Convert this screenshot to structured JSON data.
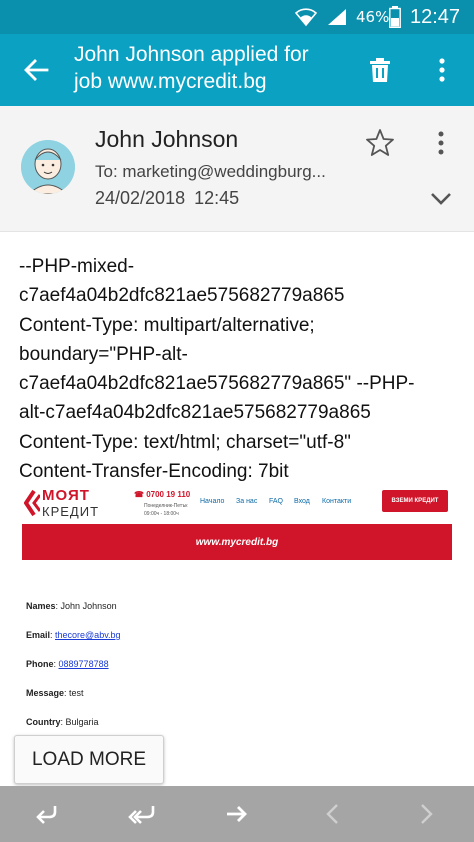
{
  "status_bar": {
    "battery": "46%",
    "time": "12:47"
  },
  "app_bar": {
    "title": "John Johnson applied for job www.mycredit.bg"
  },
  "email_header": {
    "sender": "John Johnson",
    "to": "To: marketing@weddingburg...",
    "date": "24/02/2018",
    "time": "12:45"
  },
  "raw_body": {
    "lines": [
      "--PHP-mixed-",
      "c7aef4a04b2dfc821ae575682779a865",
      "Content-Type: multipart/alternative;",
      "boundary=\"PHP-alt-",
      "c7aef4a04b2dfc821ae575682779a865\" --PHP-",
      "alt-c7aef4a04b2dfc821ae575682779a865",
      "Content-Type: text/html; charset=\"utf-8\"",
      "Content-Transfer-Encoding: 7bit"
    ]
  },
  "newsletter": {
    "logo_line1": "МОЯТ",
    "logo_line2": "КРЕДИТ",
    "phone": "0700 19 110",
    "hours_days": "Понеделник-Петък",
    "hours_time": "09:00ч - 18:00ч",
    "nav": [
      "Начало",
      "За нас",
      "FAQ",
      "Вход",
      "Контакти"
    ],
    "cta": "ВЗЕМИ КРЕДИТ",
    "banner": "www.mycredit.bg"
  },
  "fields": [
    {
      "label": "Names",
      "value": "John Johnson",
      "link": false
    },
    {
      "label": "Email",
      "value": "thecore@abv.bg",
      "link": true
    },
    {
      "label": "Phone",
      "value": "0889778788",
      "link": true
    },
    {
      "label": "Message",
      "value": "test",
      "link": false
    },
    {
      "label": "Country",
      "value": "Bulgaria",
      "link": false
    }
  ],
  "load_more": "LOAD MORE",
  "colors": {
    "status_bar": "#0a8fad",
    "app_bar": "#0aa1c2",
    "brand_red": "#d0152a",
    "bottom_bar": "#a5a5a5"
  },
  "icons": {
    "back": "arrow-left-icon",
    "delete": "trash-icon",
    "more": "more-vert-icon",
    "star": "star-outline-icon",
    "expand": "chevron-down-icon",
    "reply": "reply-icon",
    "reply_all": "reply-all-icon",
    "forward": "forward-icon",
    "previous": "chevron-left-icon",
    "next": "chevron-right-icon"
  }
}
